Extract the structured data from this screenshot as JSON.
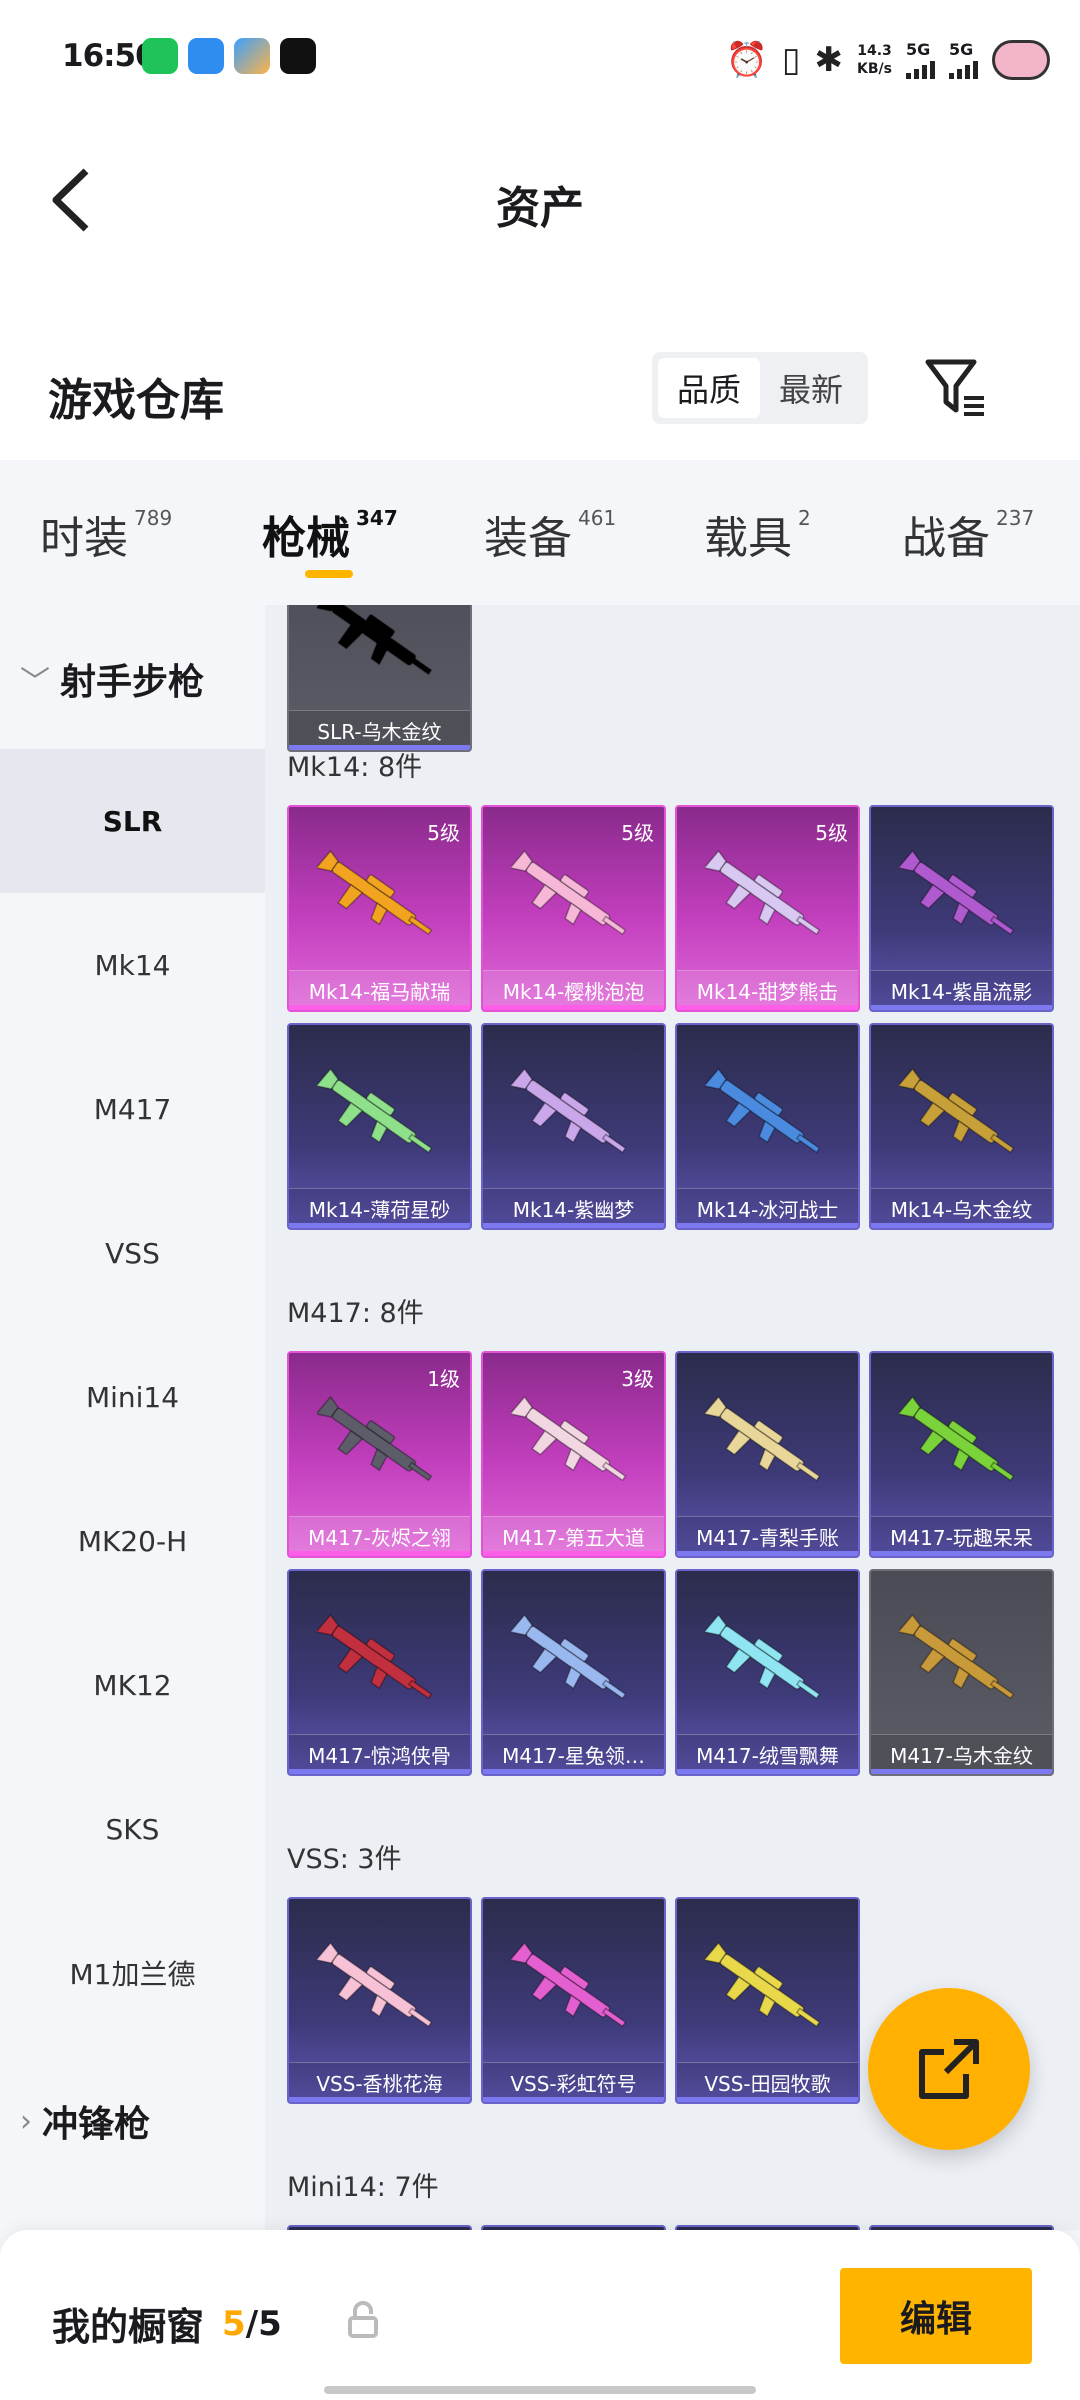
{
  "status_bar": {
    "time": "16:50",
    "speed_value": "14.3",
    "speed_unit": "KB/s",
    "signal1": "5G",
    "signal2": "5G",
    "icons": [
      "wechat-icon",
      "app-icon-blue",
      "app-icon-gradient",
      "app-icon-dewu",
      "alarm-icon",
      "vibrate-icon",
      "bluetooth-icon",
      "cloud-avatar-icon"
    ]
  },
  "header": {
    "title": "资产",
    "back_icon": "back-arrow-icon"
  },
  "section": {
    "title": "游戏仓库",
    "sort_options": [
      "品质",
      "最新"
    ],
    "sort_active": "品质",
    "filter_icon": "filter-icon"
  },
  "tabs": [
    {
      "label": "时装",
      "count": "789"
    },
    {
      "label": "枪械",
      "count": "347"
    },
    {
      "label": "装备",
      "count": "461"
    },
    {
      "label": "载具",
      "count": "2"
    },
    {
      "label": "战备",
      "count": "237"
    }
  ],
  "active_tab": "枪械",
  "sidebar": {
    "category1": "射手步枪",
    "items": [
      "SLR",
      "Mk14",
      "M417",
      "VSS",
      "Mini14",
      "MK20-H",
      "MK12",
      "SKS",
      "M1加兰德"
    ],
    "active_item": "SLR",
    "category2": "冲锋枪"
  },
  "content": {
    "partial_card": {
      "name": "SLR-乌木金纹",
      "rarity": "grey"
    },
    "groups": [
      {
        "label": "Mk14: 8件",
        "items": [
          {
            "name": "Mk14-福马献瑞",
            "level": "5级",
            "rarity": "pink",
            "gun_color": "#f2a31f"
          },
          {
            "name": "Mk14-樱桃泡泡",
            "level": "5级",
            "rarity": "pink",
            "gun_color": "#f7b8d8"
          },
          {
            "name": "Mk14-甜梦熊击",
            "level": "5级",
            "rarity": "pink",
            "gun_color": "#d9c8f2"
          },
          {
            "name": "Mk14-紫晶流影",
            "level": "",
            "rarity": "blue",
            "gun_color": "#b05ad0"
          },
          {
            "name": "Mk14-薄荷星砂",
            "level": "",
            "rarity": "blue",
            "gun_color": "#8fe08a"
          },
          {
            "name": "Mk14-紫幽梦",
            "level": "",
            "rarity": "blue",
            "gun_color": "#c9a7ea"
          },
          {
            "name": "Mk14-冰河战士",
            "level": "",
            "rarity": "blue",
            "gun_color": "#4a8be0"
          },
          {
            "name": "Mk14-乌木金纹",
            "level": "",
            "rarity": "blue",
            "gun_color": "#c8a03a"
          }
        ]
      },
      {
        "label": "M417: 8件",
        "items": [
          {
            "name": "M417-灰烬之翎",
            "level": "1级",
            "rarity": "pink",
            "gun_color": "#5d5d6a"
          },
          {
            "name": "M417-第五大道",
            "level": "3级",
            "rarity": "pink",
            "gun_color": "#f2d7e3"
          },
          {
            "name": "M417-青梨手账",
            "level": "",
            "rarity": "blue",
            "gun_color": "#e9d79a"
          },
          {
            "name": "M417-玩趣呆呆",
            "level": "",
            "rarity": "blue",
            "gun_color": "#7ad33a"
          },
          {
            "name": "M417-惊鸿侠骨",
            "level": "",
            "rarity": "blue",
            "gun_color": "#c23040"
          },
          {
            "name": "M417-星兔领…",
            "level": "",
            "rarity": "blue",
            "gun_color": "#9ab8f0"
          },
          {
            "name": "M417-绒雪飘舞",
            "level": "",
            "rarity": "blue",
            "gun_color": "#8fe6f2"
          },
          {
            "name": "M417-乌木金纹",
            "level": "",
            "rarity": "grey",
            "gun_color": "#c99a3a"
          }
        ]
      },
      {
        "label": "VSS: 3件",
        "items": [
          {
            "name": "VSS-香桃花海",
            "level": "",
            "rarity": "blue",
            "gun_color": "#f7c1d6"
          },
          {
            "name": "VSS-彩虹符号",
            "level": "",
            "rarity": "blue",
            "gun_color": "#e45fd0"
          },
          {
            "name": "VSS-田园牧歌",
            "level": "",
            "rarity": "blue",
            "gun_color": "#e8d84a"
          }
        ]
      },
      {
        "label": "Mini14: 7件",
        "items": [
          {
            "name": "",
            "level": "",
            "rarity": "blue",
            "gun_color": "#d0d0e0"
          },
          {
            "name": "",
            "level": "",
            "rarity": "blue",
            "gun_color": "#f2a0b8"
          },
          {
            "name": "",
            "level": "",
            "rarity": "blue",
            "gun_color": "#d8d0a0"
          },
          {
            "name": "",
            "level": "",
            "rarity": "blue",
            "gun_color": "#f0c0b0"
          }
        ]
      }
    ]
  },
  "fab": {
    "icon": "share-out-icon"
  },
  "bottom": {
    "label": "我的橱窗",
    "count_current": "5",
    "count_total": "/5",
    "lock_icon": "lock-icon",
    "edit_label": "编辑"
  },
  "colors": {
    "accent": "#ffb400",
    "pink_card": "#c33fbe",
    "blue_card": "#3e3a78",
    "grey_card": "#5c5d66"
  }
}
